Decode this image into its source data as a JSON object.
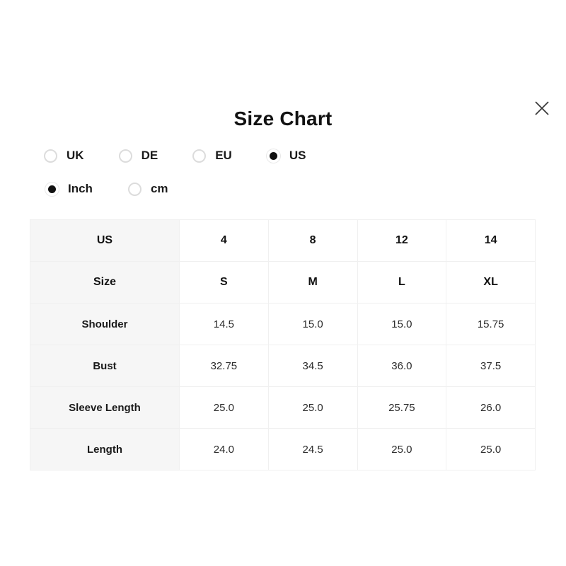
{
  "modal": {
    "title": "Size Chart",
    "close_icon": "close-icon",
    "close_label": "Close"
  },
  "region_selector": {
    "name": "region",
    "selected": "US",
    "options": [
      {
        "label": "UK",
        "selected": false
      },
      {
        "label": "DE",
        "selected": false
      },
      {
        "label": "EU",
        "selected": false
      },
      {
        "label": "US",
        "selected": true
      }
    ]
  },
  "unit_selector": {
    "name": "unit",
    "selected": "Inch",
    "options": [
      {
        "label": "Inch",
        "selected": true
      },
      {
        "label": "cm",
        "selected": false
      }
    ]
  },
  "chart_data": {
    "type": "table",
    "title": "Size Chart",
    "unit": "Inch",
    "region": "US",
    "columns": [
      "US",
      "4",
      "8",
      "12",
      "14"
    ],
    "rows": [
      {
        "label": "Size",
        "values": [
          "S",
          "M",
          "L",
          "XL"
        ]
      },
      {
        "label": "Shoulder",
        "values": [
          "14.5",
          "15.0",
          "15.0",
          "15.75"
        ]
      },
      {
        "label": "Bust",
        "values": [
          "32.75",
          "34.5",
          "36.0",
          "37.5"
        ]
      },
      {
        "label": "Sleeve Length",
        "values": [
          "25.0",
          "25.0",
          "25.75",
          "26.0"
        ]
      },
      {
        "label": "Length",
        "values": [
          "24.0",
          "24.5",
          "25.0",
          "25.0"
        ]
      }
    ]
  },
  "colors": {
    "background": "#ffffff",
    "text": "#1a1a1a",
    "row_head_bg": "#f6f6f6",
    "border": "#f0f0f0",
    "radio_off": "#dcdcdc",
    "radio_on": "#111111"
  }
}
